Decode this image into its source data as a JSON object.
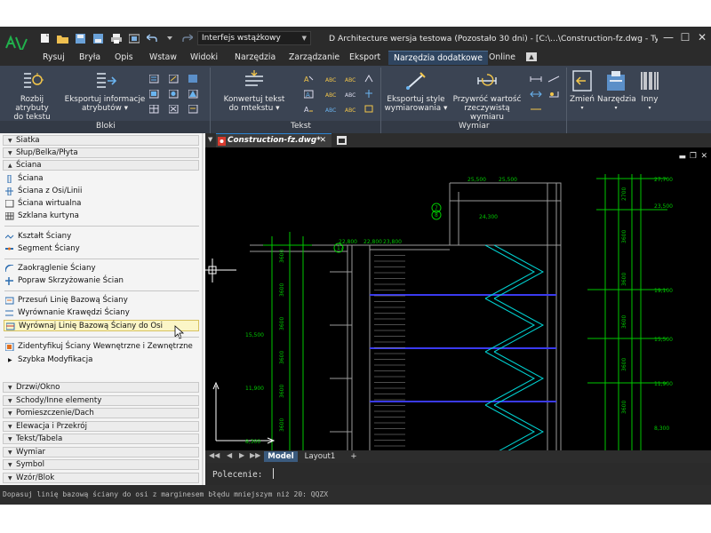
{
  "title_bar": {
    "interface_select": "Interfejs wstążkowy",
    "window_title": "D Architecture wersja testowa (Pozostało 30 dni) - [C:\\...\\Construction-fz.dwg - Tylko do oc",
    "minimize": "—",
    "maximize": "☐",
    "accent": "#2b84d3"
  },
  "ribbon_tabs": [
    "Rysuj",
    "Bryła",
    "Opis",
    "Wstaw",
    "Widoki",
    "Narzędzia",
    "Zarządzanie",
    "Eksport",
    "Narzędzia dodatkowe",
    "Online"
  ],
  "ribbon": {
    "bloki": {
      "label": "Bloki",
      "btn1": "Rozbij atrybuty\ndo tekstu",
      "btn2": "Eksportuj informacje\natrybutów ▾"
    },
    "tekst": {
      "label": "Tekst",
      "btn1": "Konwertuj tekst\ndo mtekstu ▾"
    },
    "wymiar": {
      "label": "Wymiar",
      "btn1": "Eksportuj style\nwymiarowania ▾",
      "btn2": "Przywróć wartość\nrzeczywistą wymiaru"
    },
    "right": {
      "zmien": "Zmień",
      "narzedzia": "Narzędzia",
      "inny": "Inny"
    }
  },
  "palette": {
    "top_categories": [
      "Siatka",
      "Słup/Belka/Płyta",
      "Ściana"
    ],
    "items": [
      "Ściana",
      "Ściana z Osi/Linii",
      "Ściana wirtualna",
      "Szklana kurtyna",
      "Kształt Ściany",
      "Segment Ściany",
      "Zaokrąglenie Ściany",
      "Popraw Skrzyżowanie Ścian",
      "Przesuń Linię Bazową Ściany",
      "Wyrównanie Krawędzi Ściany",
      "Wyrównaj Linię Bazową Ściany do Osi",
      "Zidentyfikuj Ściany Wewnętrzne i Zewnętrzne",
      "Szybka Modyfikacja"
    ],
    "bottom_categories": [
      "Drzwi/Okno",
      "Schody/Inne elementy",
      "Pomieszczenie/Dach",
      "Elewacja i Przekrój",
      "Tekst/Tabela",
      "Wymiar",
      "Symbol",
      "Wzór/Blok"
    ]
  },
  "document": {
    "tab_name": "Construction-fz.dwg*",
    "layout_tabs": [
      "Model",
      "Layout1",
      "+"
    ]
  },
  "drawing": {
    "left_levels": [
      "15,500",
      "11,900",
      "8,300"
    ],
    "left_top_labels": [
      "22,800",
      "22,800",
      "23,800"
    ],
    "left_dims": [
      "3600",
      "3600",
      "3600",
      "3600",
      "3600",
      "3600"
    ],
    "right_levels": [
      "27,700",
      "23,500",
      "19,100",
      "15,500",
      "11,900",
      "8,300"
    ],
    "right_dims": [
      "2700",
      "3600",
      "3600",
      "3600",
      "3600",
      "3600"
    ],
    "top_labels": [
      "25,500",
      "24,300",
      "25,500"
    ],
    "grid_bubbles": [
      "7",
      "8",
      "17"
    ],
    "line_color": "#00c800",
    "stair_color": "#00d2d2",
    "slab_color": "#3a3af0"
  },
  "command": {
    "prompt": "Polecenie:"
  },
  "status": {
    "text": "Dopasuj linię bazową ściany do osi z marginesem błędu mniejszym niż 20: QQZX"
  }
}
